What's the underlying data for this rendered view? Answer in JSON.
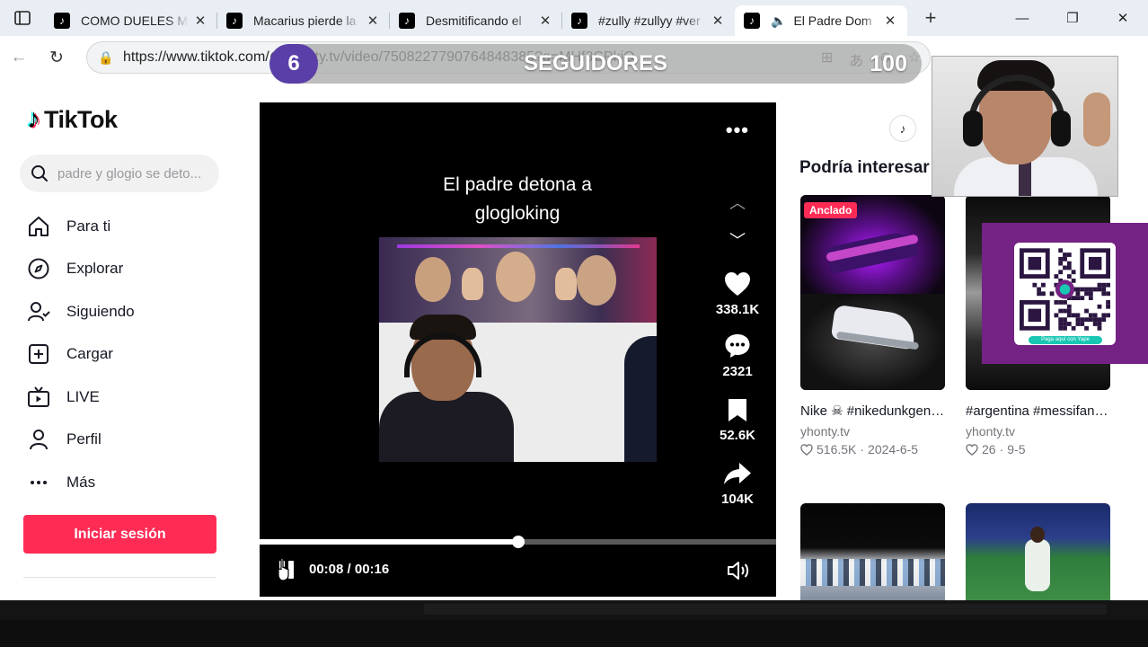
{
  "browser": {
    "tabs": [
      {
        "title": "COMO DUELES MI",
        "active": false
      },
      {
        "title": "Macarius pierde la",
        "active": false
      },
      {
        "title": "Desmitificando el",
        "active": false
      },
      {
        "title": "#zully #zullyy #ver",
        "active": false
      },
      {
        "title": "El Padre Dom",
        "active": true
      }
    ],
    "new_tab": "+",
    "url": "https://www.tiktok.com/@yhonty.tv/video/7508227790764848385?q=MHf3CPkjQ"
  },
  "overlay": {
    "badge": "6",
    "label": "SEGUIDORES",
    "count": "100"
  },
  "sidebar": {
    "logo_text": "TikTok",
    "search_placeholder": "padre y glogio se deto...",
    "items": [
      {
        "label": "Para ti",
        "icon": "home-icon"
      },
      {
        "label": "Explorar",
        "icon": "compass-icon"
      },
      {
        "label": "Siguiendo",
        "icon": "following-icon"
      },
      {
        "label": "Cargar",
        "icon": "upload-icon"
      },
      {
        "label": "LIVE",
        "icon": "live-icon"
      },
      {
        "label": "Perfil",
        "icon": "profile-icon"
      },
      {
        "label": "Más",
        "icon": "more-icon"
      }
    ],
    "login_label": "Iniciar sesión"
  },
  "video": {
    "caption": "El padre detona a glogloking",
    "likes": "338.1K",
    "comments": "2321",
    "saves": "52.6K",
    "shares": "104K",
    "time": "00:08 / 00:16",
    "progress": 0.5
  },
  "right": {
    "heading": "Podría interesar",
    "cards": [
      {
        "pin": "Anclado",
        "title": "Nike ☠ #nikedunkgenesis...",
        "user": "yhonty.tv",
        "likes": "516.5K",
        "date": "2024-6-5"
      },
      {
        "pin": "",
        "title": "#argentina #messifans...",
        "user": "yhonty.tv",
        "likes": "26",
        "date": "9-5"
      }
    ]
  },
  "yape": {
    "button_text": "Paga aquí con Yape"
  },
  "colors": {
    "tiktok_red": "#fe2c55",
    "yape_purple": "#742283",
    "overlay_badge": "#5b3fa8"
  }
}
